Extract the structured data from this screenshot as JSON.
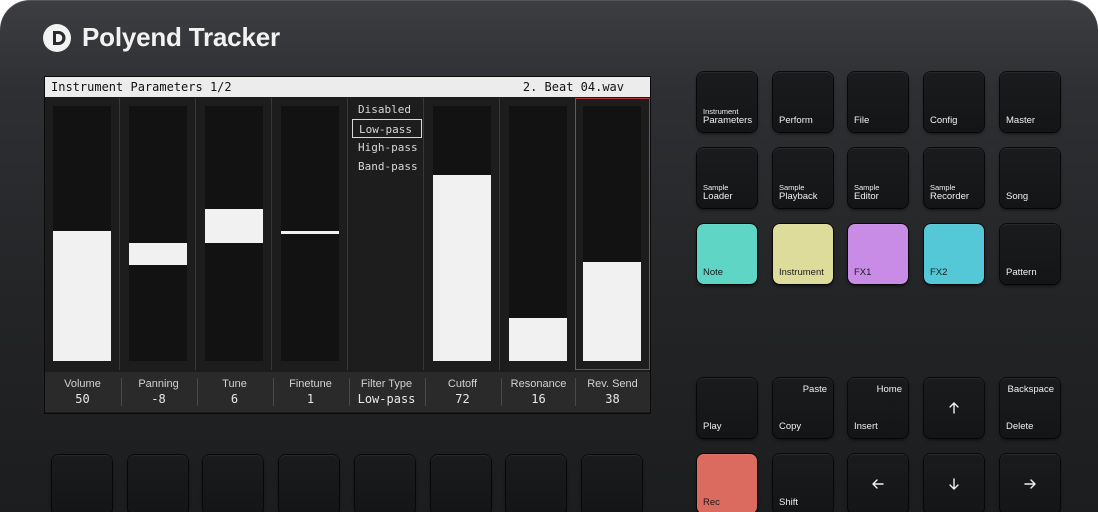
{
  "brand": {
    "name": "Polyend Tracker",
    "logo_icon": "polyend-logo-icon"
  },
  "screen": {
    "title": "Instrument Parameters 1/2",
    "instrument": "2. Beat 04.wav",
    "selected_color": "#b23a3a",
    "params": [
      {
        "name": "Volume",
        "value": "50",
        "level": 0.51
      },
      {
        "name": "Panning",
        "value": "-8",
        "level": 0.42
      },
      {
        "name": "Tune",
        "value": "6",
        "level": 0.53
      },
      {
        "name": "Finetune",
        "value": "1",
        "level": 0.505
      },
      {
        "name": "Filter Type",
        "value": "Low-pass",
        "options": [
          "Disabled",
          "Low-pass",
          "High-pass",
          "Band-pass"
        ],
        "selected": 1
      },
      {
        "name": "Cutoff",
        "value": "72",
        "level": 0.73
      },
      {
        "name": "Resonance",
        "value": "16",
        "level": 0.17
      },
      {
        "name": "Rev. Send",
        "value": "38",
        "level": 0.39,
        "selected": true
      }
    ]
  },
  "pads": {
    "instrument_parameters": {
      "small": "Instrument",
      "label": "Parameters"
    },
    "perform": "Perform",
    "file": "File",
    "config": "Config",
    "master": "Master",
    "sample_loader": {
      "small": "Sample",
      "label": "Loader"
    },
    "sample_playback": {
      "small": "Sample",
      "label": "Playback"
    },
    "sample_editor": {
      "small": "Sample",
      "label": "Editor"
    },
    "sample_recorder": {
      "small": "Sample",
      "label": "Recorder"
    },
    "song": "Song",
    "note": "Note",
    "instrument": "Instrument",
    "fx1": "FX1",
    "fx2": "FX2",
    "pattern": "Pattern",
    "play": "Play",
    "copy": "Copy",
    "paste": "Paste",
    "insert": "Insert",
    "home": "Home",
    "backspace": "Backspace",
    "delete": "Delete",
    "rec": "Rec",
    "shift": "Shift",
    "colors": {
      "note": "#5fd6c5",
      "instrument": "#dddc9a",
      "fx1": "#c98ce6",
      "fx2": "#54c8d6",
      "rec": "#dc6b5f"
    },
    "arrow_icons": [
      "arrow-up-icon",
      "arrow-left-icon",
      "arrow-down-icon",
      "arrow-right-icon"
    ]
  }
}
